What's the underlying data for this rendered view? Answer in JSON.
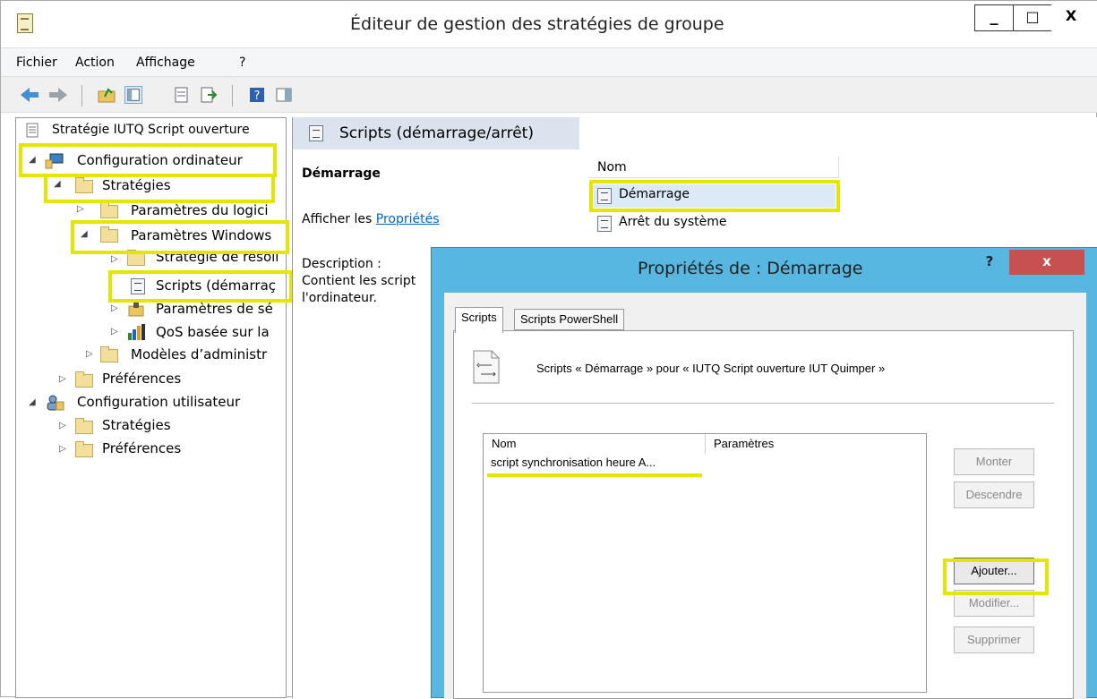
{
  "window": {
    "title": "Éditeur de gestion des stratégies de groupe",
    "minimize": "_",
    "maximize": "□",
    "close": "X"
  },
  "menu": [
    "Fichier",
    "Action",
    "Affichage",
    "?"
  ],
  "tree": {
    "root": "Stratégie IUTQ Script ouverture",
    "items": [
      "Configuration ordinateur",
      "Stratégies",
      "Paramètres du logici",
      "Paramètres Windows",
      "Stratégie de résoll",
      "Scripts (démarraç",
      "Paramètres de sé",
      "QoS basée sur la",
      "Modèles d’administr",
      "Préférences",
      "Configuration utilisateur",
      "Stratégies",
      "Préférences"
    ]
  },
  "right": {
    "header": "Scripts (démarrage/arrêt)",
    "section_title": "Démarrage",
    "afficher_prefix": "Afficher les ",
    "afficher_link": "Propriétés",
    "description_label": "Description :",
    "description_line1": "Contient les script",
    "description_line2": "l'ordinateur.",
    "col_name": "Nom",
    "list": [
      "Démarrage",
      "Arrêt du système"
    ]
  },
  "dialog": {
    "title": "Propriétés de : Démarrage",
    "help": "?",
    "close": "x",
    "tabs": [
      "Scripts",
      "Scripts PowerShell"
    ],
    "heading": "Scripts « Démarrage » pour « IUTQ Script ouverture IUT Quimper »",
    "col_name": "Nom",
    "col_params": "Paramètres",
    "rows": [
      {
        "name": "script synchronisation heure A...",
        "params": ""
      }
    ],
    "buttons": {
      "up": "Monter",
      "down": "Descendre",
      "add": "Ajouter...",
      "edit": "Modifier...",
      "delete": "Supprimer"
    }
  },
  "colors": {
    "highlight": "#e5e600",
    "dialog_frame": "#58b7e0",
    "close_red": "#c75050",
    "link": "#0066cc"
  }
}
